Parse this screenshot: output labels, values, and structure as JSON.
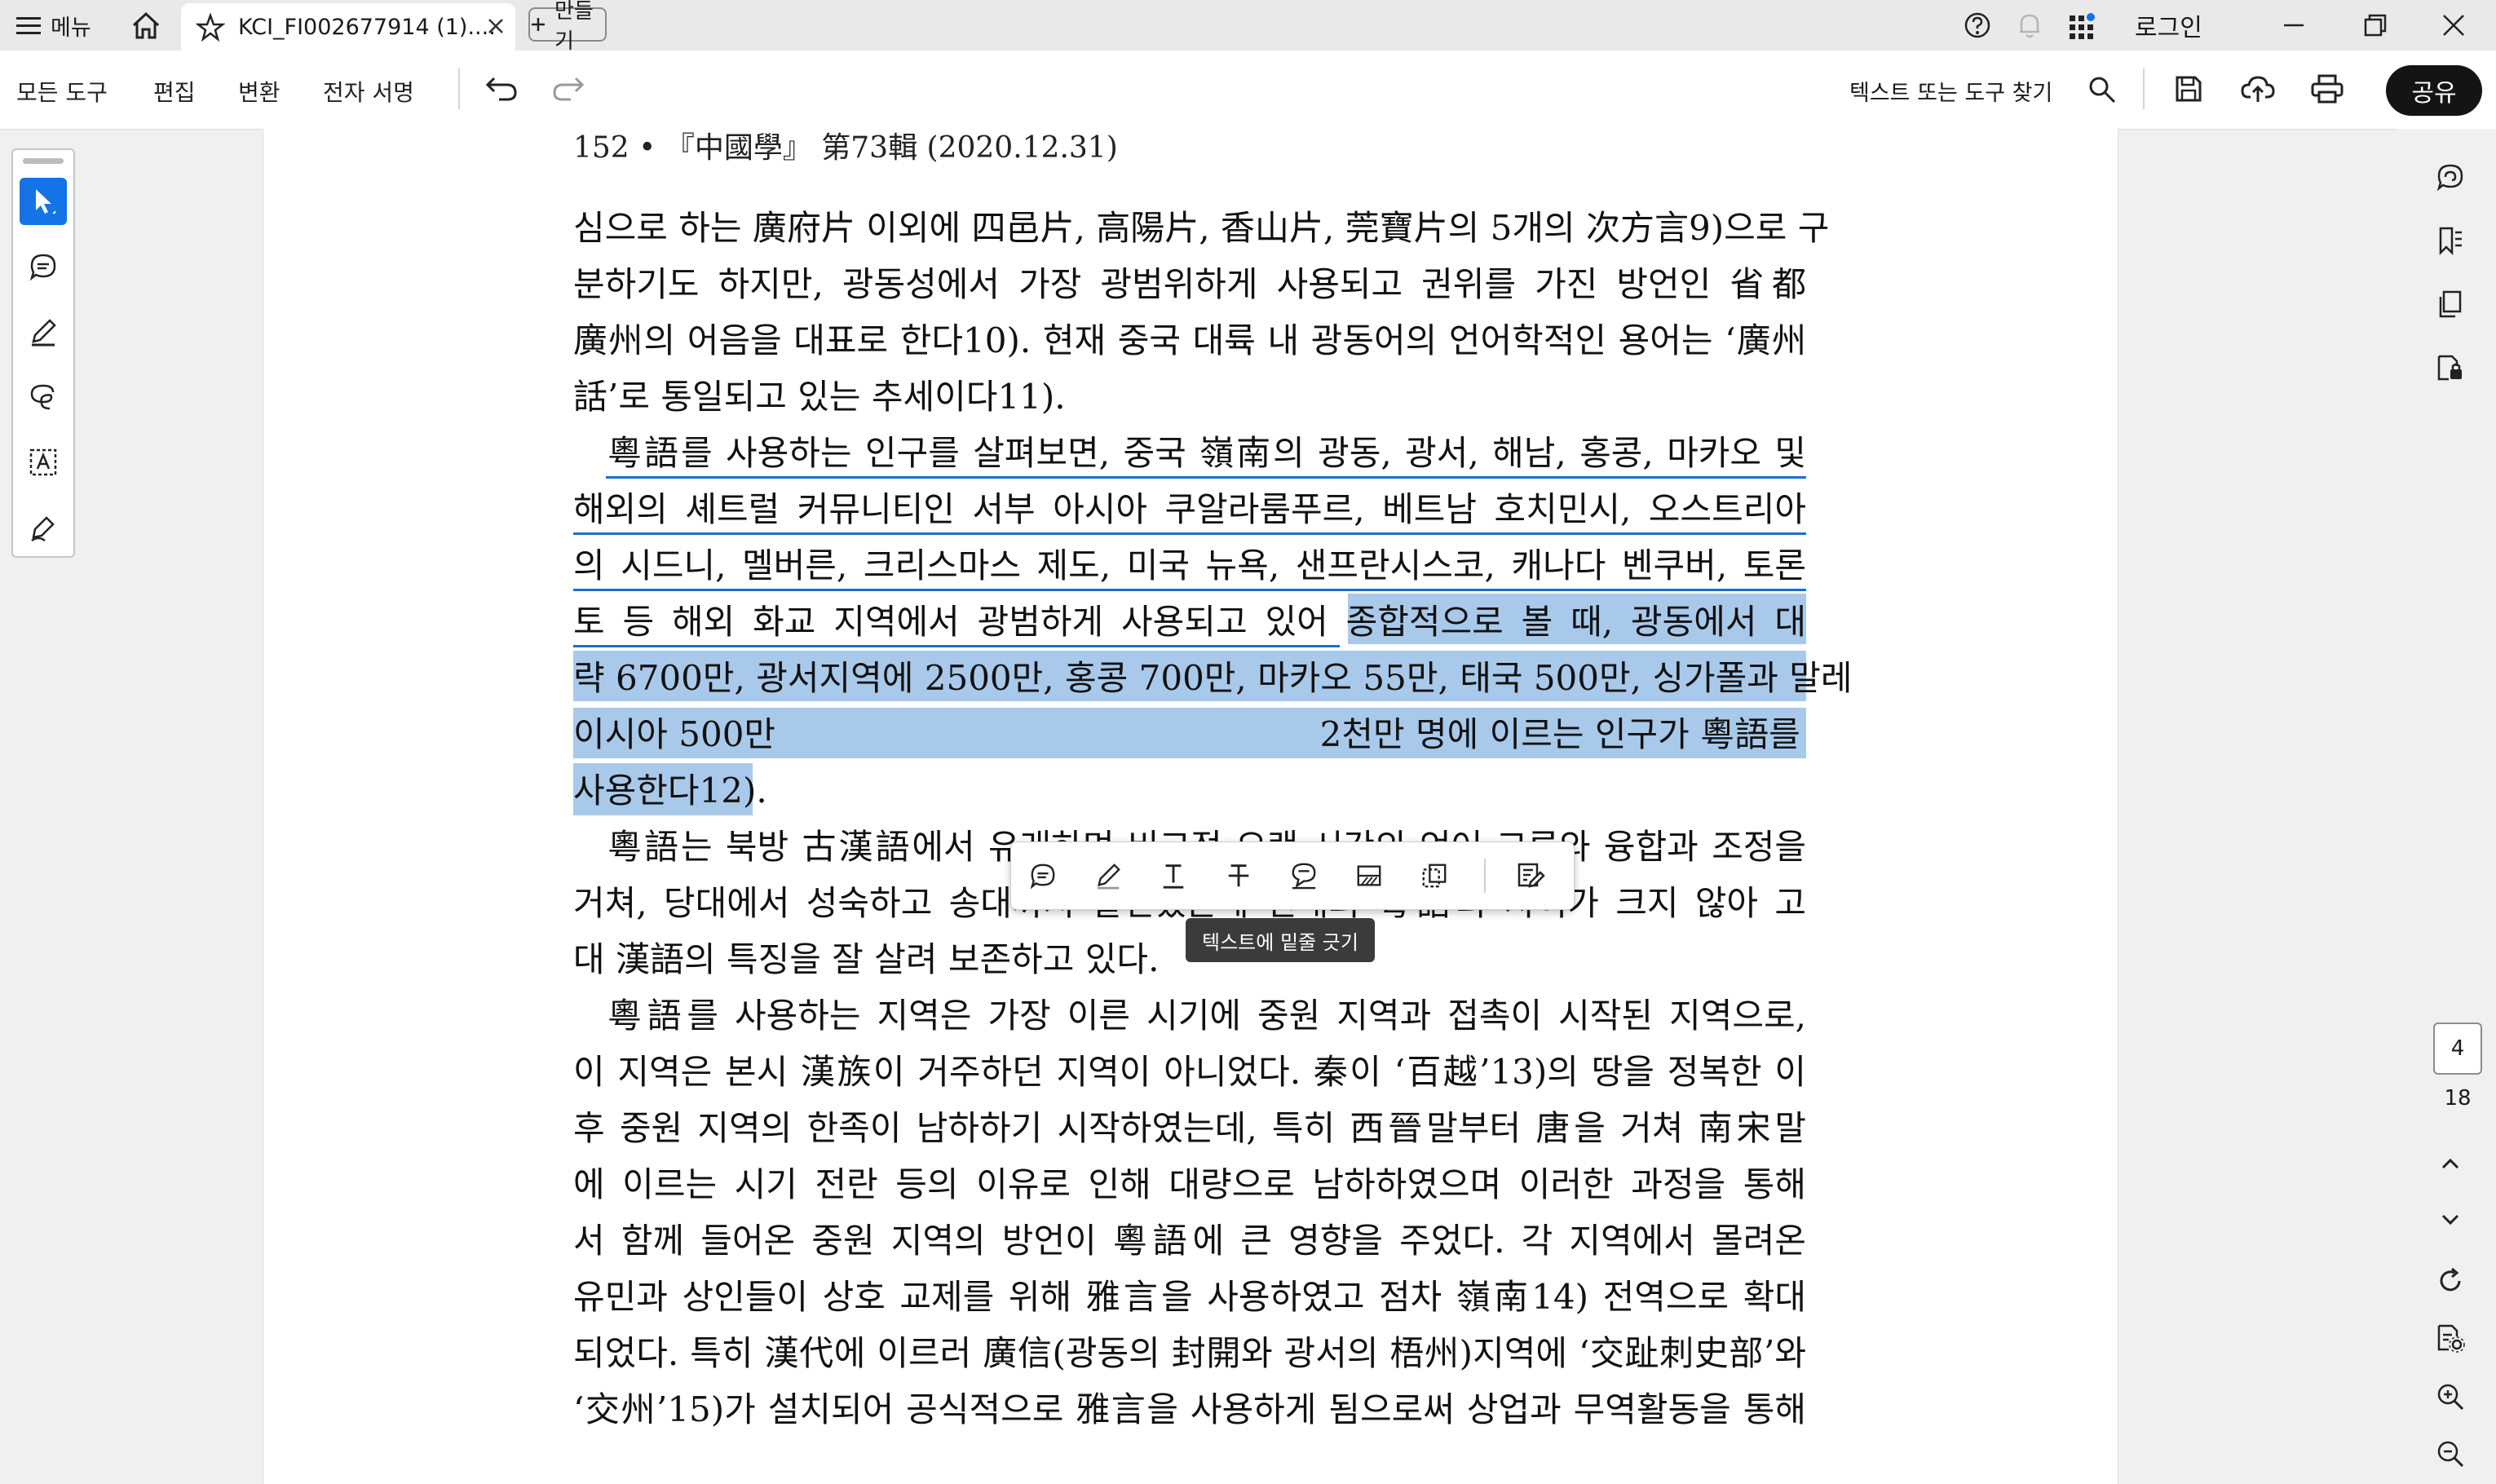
{
  "titlebar": {
    "menu_label": "메뉴",
    "tab_title": "KCI_FI002677914 (1)....",
    "new_tab_label": "만들기",
    "login_label": "로그인"
  },
  "toolbar": {
    "menus": [
      "모든 도구",
      "편집",
      "변환",
      "전자 서명"
    ],
    "find_label": "텍스트 또는 도구 찾기",
    "share_label": "공유"
  },
  "document": {
    "running_head": "152 • 『中國學』 第73輯 (2020.12.31)",
    "lines": [
      "심으로 하는 廣府片 이외에 四邑片, 高陽片, 香山片, 莞寶片의 5개의 次方言9)으로 구",
      "분하기도 하지만, 광동성에서 가장 광범위하게 사용되고 권위를 가진 방언인 省都",
      "廣州의 어음을 대표로 한다10). 현재 중국 대륙 내 광동어의 언어학적인 용어는 ‘廣州",
      "話’로 통일되고 있는 추세이다11).",
      "粵語를 사용하는 인구를 살펴보면, 중국 嶺南의 광동, 광서, 해남, 홍콩, 마카오 및",
      "해외의 셰트럴 커뮤니티인 서부 아시아 쿠알라룸푸르, 베트남 호치민시, 오스트리아",
      "의 시드니, 멜버른, 크리스마스 제도, 미국 뉴욕, 샌프란시스코, 캐나다 벤쿠버, 토론",
      "토 등 해외 화교 지역에서 광범하게 사용되고 있어 종합적으로 볼 때, 광동에서 대",
      "략 6700만, 광서지역에 2500만, 홍콩 700만, 마카오 55만, 태국 500만, 싱가폴과 말레",
      "이시아 500만                                                  2천만 명에 이르는 인구가 粵語를",
      "사용한다12).",
      "粵語는 북방 古漢語에서 유래하며 비교적 오랜 시간의 언어 교류와 융합과 조정을",
      "거쳐, 당대에서 성숙하고 송대까지 발전했는데 현대의 粵語와 차이가 크지 않아 고",
      "대 漢語의 특징을 잘 살려 보존하고 있다.",
      "粵語를 사용하는 지역은 가장 이른 시기에 중원 지역과 접촉이 시작된 지역으로,",
      "이 지역은 본시 漢族이 거주하던 지역이 아니었다. 秦이 ‘百越’13)의 땅을 정복한 이",
      "후 중원 지역의 한족이 남하하기 시작하였는데, 특히 西晉말부터 唐을 거쳐 南宋말",
      "에 이르는 시기 전란 등의 이유로 인해 대량으로 남하하였으며 이러한 과정을 통해",
      "서 함께 들어온 중원 지역의 방언이 粵語에 큰 영향을 주었다. 각 지역에서 몰려온",
      "유민과 상인들이 상호 교제를 위해 雅言을 사용하였고 점차 嶺南14) 전역으로 확대",
      "되었다. 특히 漢代에 이르러 廣信(광동의 封開와 광서의 梧州)지역에 ‘交趾刺史部’와",
      "‘交州’15)가 설치되어 공식적으로 雅言을 사용하게 됨으로써 상업과 무역활동을 통해"
    ]
  },
  "context_toolbar": {
    "tooltip": "텍스트에 밑줄 긋기"
  },
  "pages": {
    "current": "4",
    "total": "18"
  }
}
